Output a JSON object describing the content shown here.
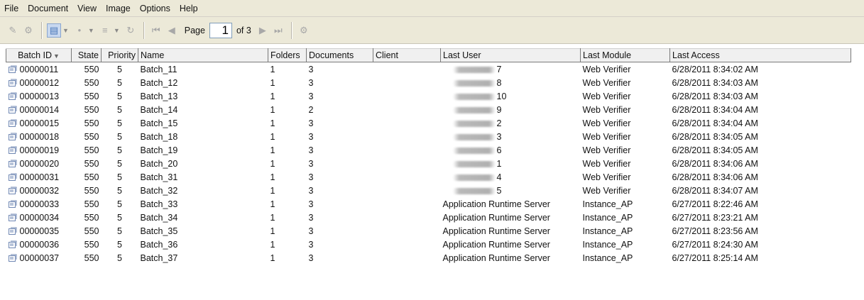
{
  "menu": [
    "File",
    "Document",
    "View",
    "Image",
    "Options",
    "Help"
  ],
  "toolbar": {
    "page_label": "Page",
    "page_value": "1",
    "page_of": "of 3"
  },
  "columns": [
    "Batch ID",
    "State",
    "Priority",
    "Name",
    "Folders",
    "Documents",
    "Client",
    "Last User",
    "Last Module",
    "Last Access"
  ],
  "rows": [
    {
      "id": "00000011",
      "state": "550",
      "priority": "5",
      "name": "Batch_11",
      "folders": "1",
      "documents": "3",
      "client": "",
      "user": "7",
      "user_redacted": true,
      "module": "Web Verifier",
      "access": "6/28/2011 8:34:02 AM"
    },
    {
      "id": "00000012",
      "state": "550",
      "priority": "5",
      "name": "Batch_12",
      "folders": "1",
      "documents": "3",
      "client": "",
      "user": "8",
      "user_redacted": true,
      "module": "Web Verifier",
      "access": "6/28/2011 8:34:03 AM"
    },
    {
      "id": "00000013",
      "state": "550",
      "priority": "5",
      "name": "Batch_13",
      "folders": "1",
      "documents": "3",
      "client": "",
      "user": "10",
      "user_redacted": true,
      "module": "Web Verifier",
      "access": "6/28/2011 8:34:03 AM"
    },
    {
      "id": "00000014",
      "state": "550",
      "priority": "5",
      "name": "Batch_14",
      "folders": "1",
      "documents": "2",
      "client": "",
      "user": "9",
      "user_redacted": true,
      "module": "Web Verifier",
      "access": "6/28/2011 8:34:04 AM"
    },
    {
      "id": "00000015",
      "state": "550",
      "priority": "5",
      "name": "Batch_15",
      "folders": "1",
      "documents": "3",
      "client": "",
      "user": "2",
      "user_redacted": true,
      "module": "Web Verifier",
      "access": "6/28/2011 8:34:04 AM"
    },
    {
      "id": "00000018",
      "state": "550",
      "priority": "5",
      "name": "Batch_18",
      "folders": "1",
      "documents": "3",
      "client": "",
      "user": "3",
      "user_redacted": true,
      "module": "Web Verifier",
      "access": "6/28/2011 8:34:05 AM"
    },
    {
      "id": "00000019",
      "state": "550",
      "priority": "5",
      "name": "Batch_19",
      "folders": "1",
      "documents": "3",
      "client": "",
      "user": "6",
      "user_redacted": true,
      "module": "Web Verifier",
      "access": "6/28/2011 8:34:05 AM"
    },
    {
      "id": "00000020",
      "state": "550",
      "priority": "5",
      "name": "Batch_20",
      "folders": "1",
      "documents": "3",
      "client": "",
      "user": "1",
      "user_redacted": true,
      "module": "Web Verifier",
      "access": "6/28/2011 8:34:06 AM"
    },
    {
      "id": "00000031",
      "state": "550",
      "priority": "5",
      "name": "Batch_31",
      "folders": "1",
      "documents": "3",
      "client": "",
      "user": "4",
      "user_redacted": true,
      "module": "Web Verifier",
      "access": "6/28/2011 8:34:06 AM"
    },
    {
      "id": "00000032",
      "state": "550",
      "priority": "5",
      "name": "Batch_32",
      "folders": "1",
      "documents": "3",
      "client": "",
      "user": "5",
      "user_redacted": true,
      "module": "Web Verifier",
      "access": "6/28/2011 8:34:07 AM"
    },
    {
      "id": "00000033",
      "state": "550",
      "priority": "5",
      "name": "Batch_33",
      "folders": "1",
      "documents": "3",
      "client": "",
      "user": "Application Runtime Server",
      "user_redacted": false,
      "module": "Instance_AP",
      "access": "6/27/2011 8:22:46 AM"
    },
    {
      "id": "00000034",
      "state": "550",
      "priority": "5",
      "name": "Batch_34",
      "folders": "1",
      "documents": "3",
      "client": "",
      "user": "Application Runtime Server",
      "user_redacted": false,
      "module": "Instance_AP",
      "access": "6/27/2011 8:23:21 AM"
    },
    {
      "id": "00000035",
      "state": "550",
      "priority": "5",
      "name": "Batch_35",
      "folders": "1",
      "documents": "3",
      "client": "",
      "user": "Application Runtime Server",
      "user_redacted": false,
      "module": "Instance_AP",
      "access": "6/27/2011 8:23:56 AM"
    },
    {
      "id": "00000036",
      "state": "550",
      "priority": "5",
      "name": "Batch_36",
      "folders": "1",
      "documents": "3",
      "client": "",
      "user": "Application Runtime Server",
      "user_redacted": false,
      "module": "Instance_AP",
      "access": "6/27/2011 8:24:30 AM"
    },
    {
      "id": "00000037",
      "state": "550",
      "priority": "5",
      "name": "Batch_37",
      "folders": "1",
      "documents": "3",
      "client": "",
      "user": "Application Runtime Server",
      "user_redacted": false,
      "module": "Instance_AP",
      "access": "6/27/2011 8:25:14 AM"
    }
  ]
}
